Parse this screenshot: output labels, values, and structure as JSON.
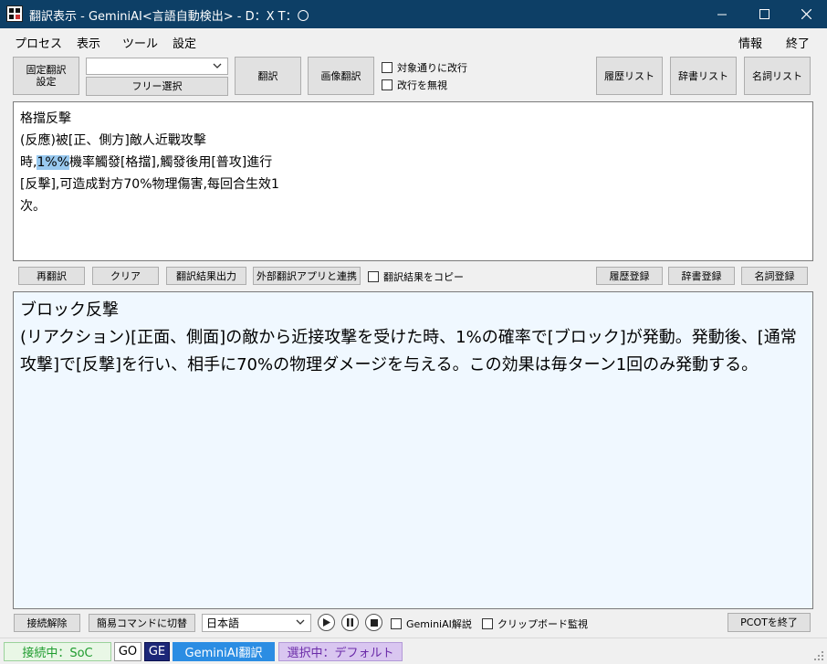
{
  "titlebar": {
    "title": "翻訳表示 - GeminiAI<言語自動検出> - D：X T：〇"
  },
  "menu": {
    "left": [
      "プロセス",
      "表示",
      "ツール",
      "設定"
    ],
    "right": [
      "情報",
      "終了"
    ]
  },
  "toolbar": {
    "fixed_translation_line1": "固定翻訳",
    "fixed_translation_line2": "設定",
    "preset_value": "",
    "free_select": "フリー選択",
    "translate": "翻訳",
    "image_translate": "画像翻訳",
    "wrap_as_target": "対象通りに改行",
    "ignore_newline": "改行を無視",
    "history_list": "履歴リスト",
    "dictionary_list": "辞書リスト",
    "noun_list": "名詞リスト"
  },
  "source": {
    "before": "格擋反擊\n(反應)被[正、側方]敵人近戰攻擊\n時,",
    "selected": "1%%",
    "after": "機率觸發[格擋],觸發後用[普攻]進行[反擊],可造成對方70%物理傷害,每回合生效1次。"
  },
  "midbar": {
    "retranslate": "再翻訳",
    "clear": "クリア",
    "output_result": "翻訳結果出力",
    "external_app": "外部翻訳アプリと連携",
    "copy_result": "翻訳結果をコピー",
    "history_register": "履歴登録",
    "dictionary_register": "辞書登録",
    "noun_register": "名詞登録"
  },
  "translation": {
    "text": "ブロック反撃\n(リアクション)[正面、側面]の敵から近接攻撃を受けた時、1%の確率で[ブロック]が発動。発動後、[通常攻撃]で[反撃]を行い、相手に70%の物理ダメージを与える。この効果は毎ターン1回のみ発動する。"
  },
  "bottombar": {
    "disconnect": "接続解除",
    "simple_command": "簡易コマンドに切替",
    "language": "日本語",
    "gemini_explain": "GeminiAI解説",
    "clipboard_monitor": "クリップボード監視",
    "quit_pcot": "PCOTを終了"
  },
  "status": {
    "connected": "接続中：SoC",
    "go": "GO",
    "ge": "GE",
    "engine": "GeminiAI翻訳",
    "selection": "選択中：デフォルト"
  },
  "colors": {
    "titlebar": "#0d3f66",
    "connected_bg": "#e9f7e6",
    "connected_fg": "#1e9b2e",
    "ge_bg": "#1c2778",
    "engine_bg": "#2b8de3",
    "selection_bg": "#d9c6f0",
    "selection_fg": "#6a2aa8"
  }
}
